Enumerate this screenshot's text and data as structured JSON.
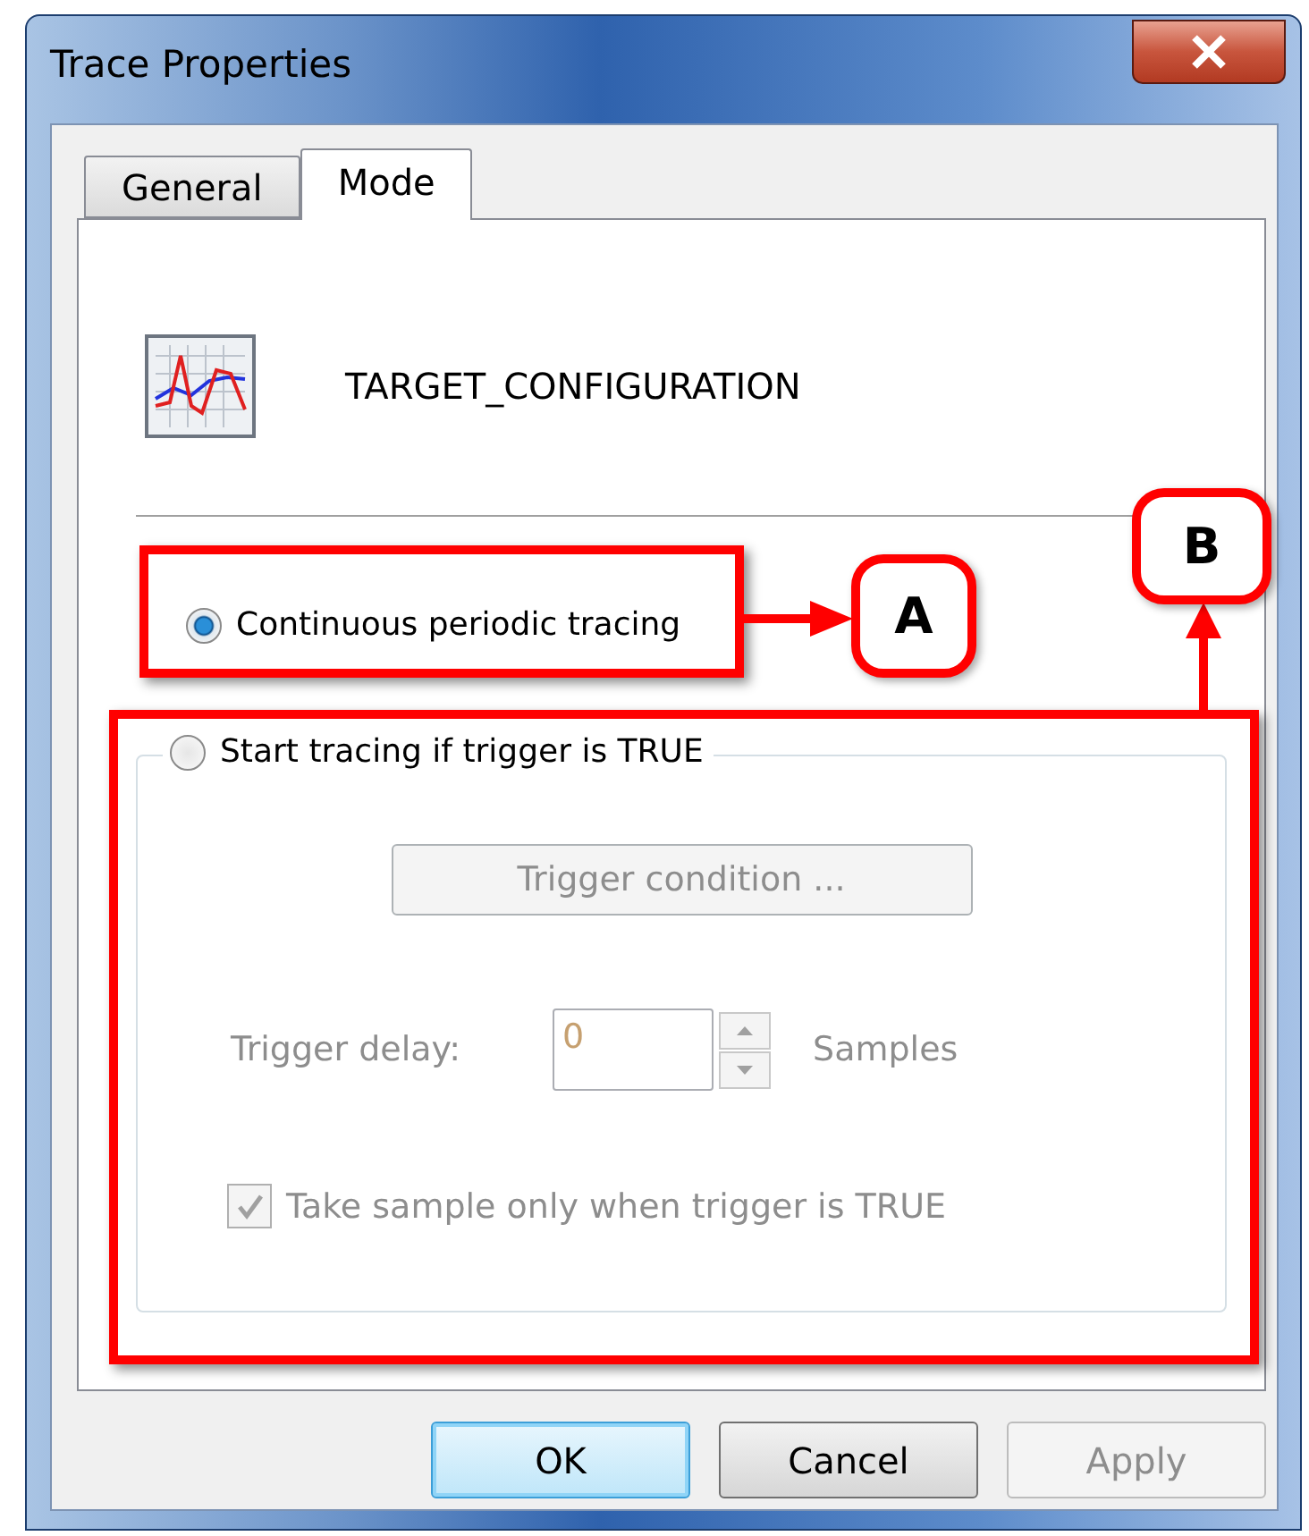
{
  "window": {
    "title": "Trace Properties"
  },
  "tabs": [
    {
      "label": "General",
      "selected": false
    },
    {
      "label": "Mode",
      "selected": true
    }
  ],
  "header": {
    "name": "TARGET_CONFIGURATION"
  },
  "modes": [
    {
      "label": "Continuous periodic tracing",
      "selected": true
    },
    {
      "label": "Start tracing if trigger is TRUE",
      "selected": false
    }
  ],
  "trigger": {
    "button": "Trigger condition ...",
    "disabled": true,
    "delay_label": "Trigger delay:",
    "delay_value": "0",
    "delay_unit": "Samples",
    "checkbox": {
      "label": "Take sample only when trigger is TRUE",
      "checked": true
    }
  },
  "buttons": [
    {
      "label": "OK",
      "kind": "default"
    },
    {
      "label": "Cancel",
      "kind": "normal"
    },
    {
      "label": "Apply",
      "kind": "disabled"
    }
  ],
  "annotations": [
    {
      "label": "A"
    },
    {
      "label": "B"
    }
  ]
}
